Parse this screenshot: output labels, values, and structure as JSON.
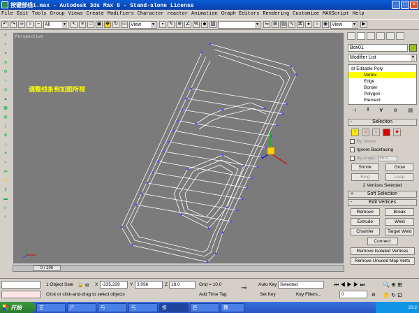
{
  "window": {
    "title": "按键部线1.max - Autodesk 3ds Max 8  - Stand-alone License"
  },
  "menu": [
    "File",
    "Edit",
    "Tools",
    "Group",
    "Views",
    "Create",
    "Modifiers",
    "Character",
    "reactor",
    "Animation",
    "Graph Editors",
    "Rendering",
    "Customize",
    "MAXScript",
    "Help"
  ],
  "toolbar": {
    "filter_select": "All",
    "view_select": "View",
    "view_select_right": "View"
  },
  "viewport": {
    "label": "Perspective",
    "caption": "调整线条到如图所视"
  },
  "timeline": {
    "frame": "0 / 100"
  },
  "command_panel": {
    "object_name": "Box01",
    "object_color": "#9ac020",
    "modifier_list": "Modifier List",
    "stack": [
      {
        "label": "Editable Poly",
        "level": "root",
        "selected": false
      },
      {
        "label": "Vertex",
        "level": "sub",
        "selected": true
      },
      {
        "label": "Edge",
        "level": "sub",
        "selected": false
      },
      {
        "label": "Border",
        "level": "sub",
        "selected": false
      },
      {
        "label": "Polygon",
        "level": "sub",
        "selected": false
      },
      {
        "label": "Element",
        "level": "sub",
        "selected": false
      }
    ],
    "selection": {
      "title": "Selection",
      "by_vertex": "By Vertex",
      "ignore_backfacing": "Ignore Backfacing",
      "by_angle": "By Angle:",
      "angle_value": "45.0",
      "shrink": "Shrink",
      "grow": "Grow",
      "ring": "Ring",
      "loop": "Loop",
      "status": "2 Vertices Selected"
    },
    "soft_selection": {
      "title": "Soft Selection"
    },
    "edit_vertices": {
      "title": "Edit Vertices",
      "remove": "Remove",
      "break": "Break",
      "extrude": "Extrude",
      "weld": "Weld",
      "chamfer": "Chamfer",
      "target_weld": "Target Weld",
      "connect": "Connect",
      "remove_isolated": "Remove Isolated Vertices",
      "remove_unused": "Remove Unused Map Verts"
    }
  },
  "status": {
    "selection_count": "1 Object Sele",
    "x_label": "X",
    "x_value": "-235.229",
    "y_label": "Y",
    "y_value": "3.096",
    "z_label": "Z",
    "z_value": "18.0",
    "grid": "Grid = 10.0",
    "auto_key": "Auto Key",
    "auto_key_select": "Selected",
    "set_key": "Set Key",
    "key_filters": "Key Filters...",
    "frame_field": "0",
    "prompt": "Click or click-and-drag to select objects",
    "add_time_tag": "Add Time Tag"
  },
  "taskbar": {
    "start": "开始",
    "tasks": [
      "艺",
      "户",
      "与",
      "与",
      "按",
      "巨",
      "魏"
    ],
    "clock": "20:2"
  }
}
